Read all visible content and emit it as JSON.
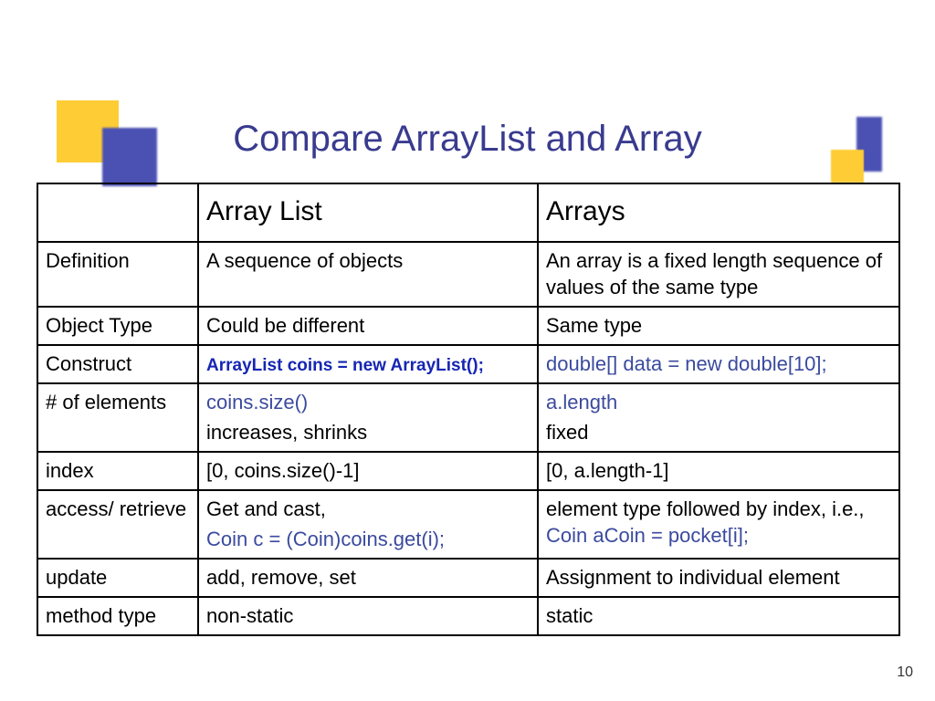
{
  "title": "Compare ArrayList and Array",
  "page_number": "10",
  "headers": {
    "blank": "",
    "col1": "Array List",
    "col2": "Arrays"
  },
  "rows": {
    "definition": {
      "label": "Definition",
      "al": "A sequence of objects",
      "ar": "An array is a fixed length sequence of values of the same type"
    },
    "objtype": {
      "label": "Object Type",
      "al": "Could be different",
      "ar": "Same type"
    },
    "construct": {
      "label": "Construct",
      "al": "ArrayList coins = new ArrayList();",
      "ar": "double[]  data = new double[10];"
    },
    "numel": {
      "label": "# of elements",
      "al_code": "coins.size()",
      "al_text": "increases, shrinks",
      "ar_code": "a.length",
      "ar_text": "fixed"
    },
    "index": {
      "label": "index",
      "al": "[0, coins.size()-1]",
      "ar": "[0, a.length-1]"
    },
    "access": {
      "label": "access/ retrieve",
      "al_text": "Get and cast,",
      "al_code": "Coin c = (Coin)coins.get(i);",
      "ar_pre": "element type followed by index, i.e., ",
      "ar_code": "Coin aCoin = pocket[i];"
    },
    "update": {
      "label": "update",
      "al": "add, remove, set",
      "ar": "Assignment to individual element"
    },
    "method": {
      "label": "method type",
      "al": "non-static",
      "ar": "static"
    }
  }
}
